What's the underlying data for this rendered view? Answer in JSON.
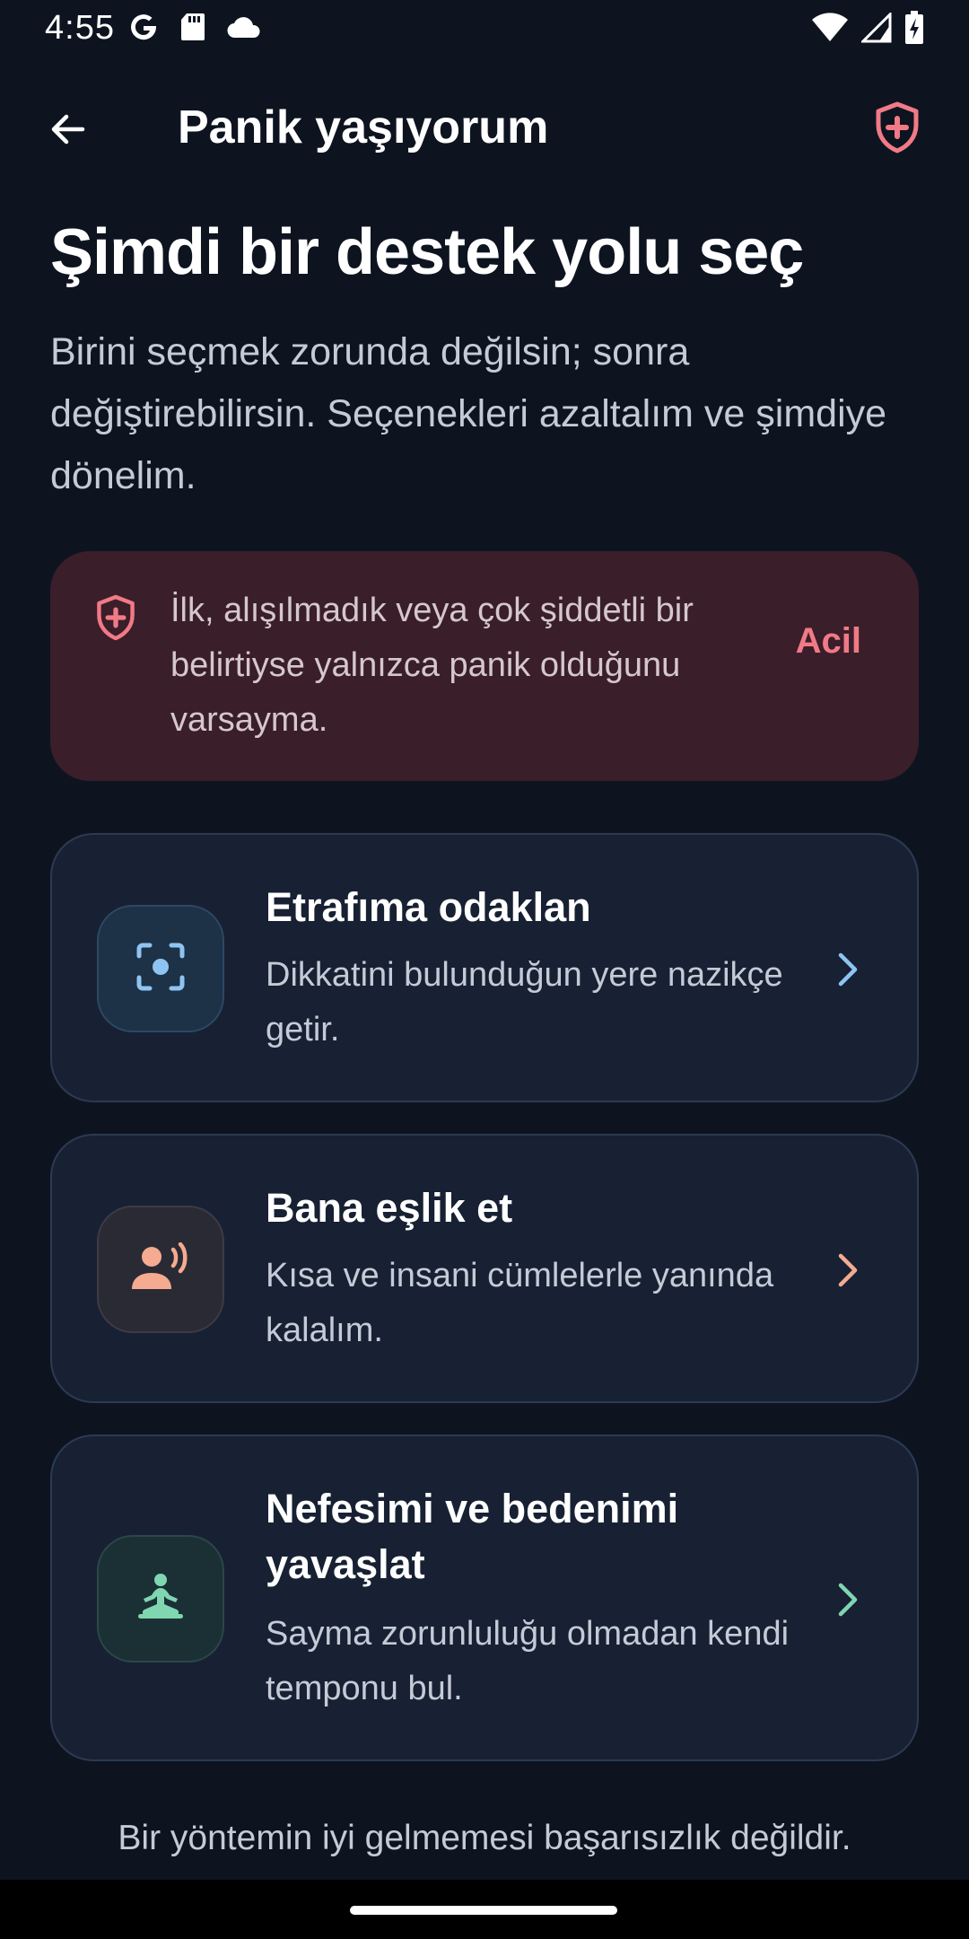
{
  "status_bar": {
    "time": "4:55",
    "icons": [
      "google-icon",
      "sd-card-icon",
      "cloud-icon",
      "wifi-icon",
      "signal-icon",
      "battery-charging-icon"
    ]
  },
  "app_bar": {
    "title": "Panik yaşıyorum",
    "back_icon": "arrow-left-icon",
    "action_icon": "shield-plus-icon"
  },
  "heading": "Şimdi bir destek yolu seç",
  "subtitle": "Birini seçmek zorunda değilsin; sonra değiştirebilirsin. Seçenekleri azaltalım ve şimdiye dönelim.",
  "alert": {
    "icon": "shield-plus-icon",
    "text": "İlk, alışılmadık veya çok şiddetli bir belirtiyse yalnızca panik olduğunu varsayma.",
    "action_label": "Acil"
  },
  "options": [
    {
      "icon": "focus-target-icon",
      "title": "Etrafıma odaklan",
      "description": "Dikkatini bulunduğun yere nazikçe getir.",
      "accent": "#8ec4f2"
    },
    {
      "icon": "person-speaking-icon",
      "title": "Bana eşlik et",
      "description": "Kısa ve insani cümlelerle yanında kalalım.",
      "accent": "#f4ab8f"
    },
    {
      "icon": "meditation-icon",
      "title": "Nefesimi ve bedenimi yavaşlat",
      "description": "Sayma zorunluluğu olmadan kendi temponu bul.",
      "accent": "#7fd6b0"
    }
  ],
  "footer": "Bir yöntemin iyi gelmemesi başarısızlık değildir.",
  "colors": {
    "background": "#0d1420",
    "card": "#172133",
    "alert_background": "#3a1e2a",
    "alert_accent": "#f07a86"
  }
}
